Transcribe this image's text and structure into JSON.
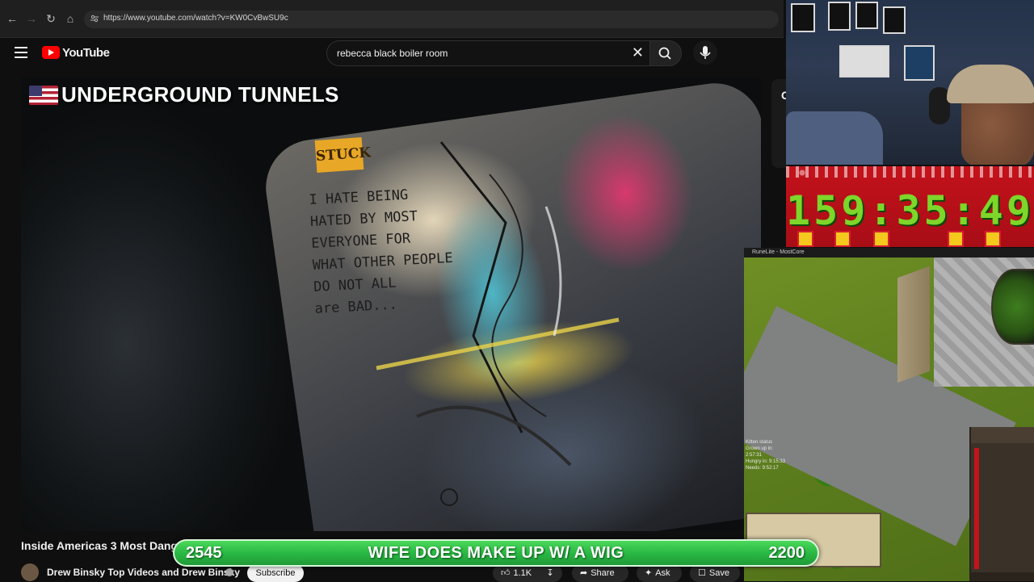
{
  "browser": {
    "url": "https://www.youtube.com/watch?v=KW0CvBwSU9c"
  },
  "youtube": {
    "logo_text": "YouTube",
    "search_query": "rebecca black boiler room"
  },
  "video": {
    "overlay_title": "UNDERGROUND TUNNELS",
    "sticker_text": "STUCK",
    "graffiti_text": "I HATE BEING\nHATED BY MOST\nEVERYONE FOR\nWHAT OTHER PEOPLE\nDO  NOT ALL\nare BAD...",
    "title": "Inside Americas 3 Most Dang",
    "channel_name": "Drew Binsky Top Videos and Drew Binsky",
    "subscribe_label": "Subscribe",
    "like_count": "1.1K",
    "share_label": "Share",
    "ask_label": "Ask",
    "save_label": "Save",
    "side_peek_char": "C"
  },
  "timer": {
    "display": "159:35:49",
    "digit_color": "#7dd62a",
    "background_color": "#c3121b"
  },
  "game": {
    "window_title": "RuneLite - MostCore",
    "status_header": "Kitten status",
    "status_lines": [
      "Grown up in: 2:57:31",
      "Hungry in: 9:15:33",
      "Needs: 9:52:17"
    ]
  },
  "banner": {
    "left_number": "2545",
    "message": "WIFE DOES MAKE UP W/ A WIG",
    "right_number": "2200",
    "color": "#2ab944"
  }
}
